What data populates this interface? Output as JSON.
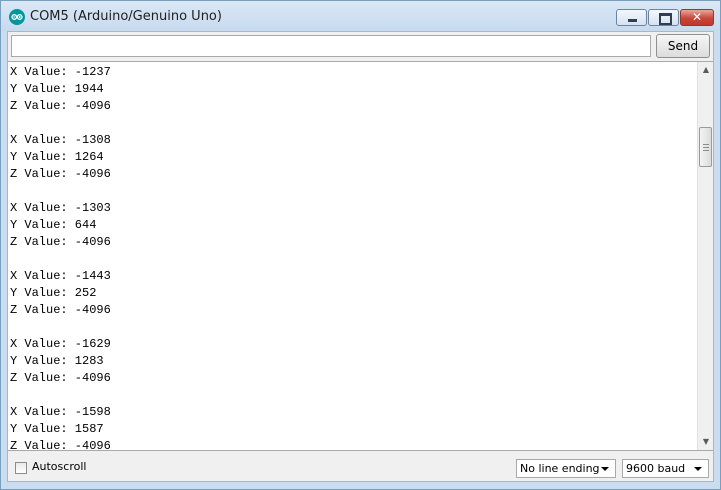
{
  "window": {
    "title": "COM5 (Arduino/Genuino Uno)",
    "close_glyph": "✕"
  },
  "input": {
    "value": "",
    "placeholder": ""
  },
  "send_button": {
    "label": "Send"
  },
  "serial_output": [
    "X Value: -1237",
    "Y Value: 1944",
    "Z Value: -4096",
    "",
    "X Value: -1308",
    "Y Value: 1264",
    "Z Value: -4096",
    "",
    "X Value: -1303",
    "Y Value: 644",
    "Z Value: -4096",
    "",
    "X Value: -1443",
    "Y Value: 252",
    "Z Value: -4096",
    "",
    "X Value: -1629",
    "Y Value: 1283",
    "Z Value: -4096",
    "",
    "X Value: -1598",
    "Y Value: 1587",
    "Z Value: -4096"
  ],
  "bottom": {
    "autoscroll_label": "Autoscroll",
    "autoscroll_checked": false,
    "line_ending": "No line ending",
    "baud_rate": "9600 baud"
  },
  "icons": [
    "arduino-logo-icon",
    "minimize-icon",
    "maximize-icon",
    "close-icon",
    "scroll-up-arrow-icon",
    "scroll-down-arrow-icon",
    "dropdown-caret-icon"
  ],
  "colors": {
    "arduino_teal": "#00979c",
    "close_red": "#c8463a"
  }
}
